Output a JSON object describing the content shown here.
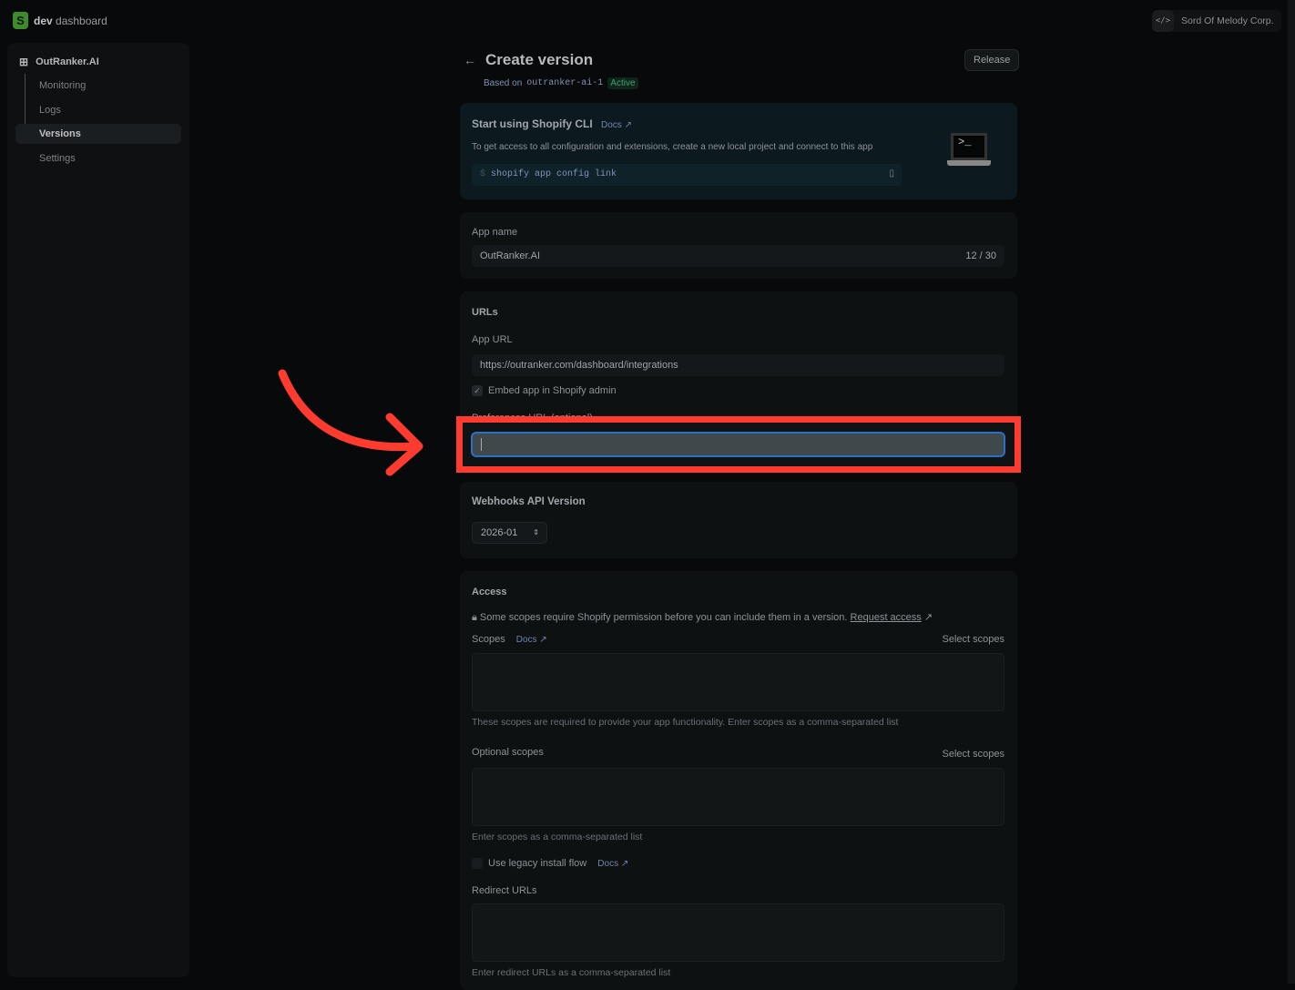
{
  "header": {
    "brand_bold": "dev",
    "brand_rest": "dashboard",
    "org_icon": "code-icon",
    "org": "Sord Of Melody Corp."
  },
  "sidebar": {
    "app": "OutRanker.AI",
    "items": [
      {
        "label": "Monitoring"
      },
      {
        "label": "Logs"
      },
      {
        "label": "Versions",
        "active": true
      },
      {
        "label": "Settings"
      }
    ]
  },
  "page": {
    "title": "Create version",
    "based_on": "Based on",
    "version": "outranker-ai-1",
    "status": "Active",
    "release": "Release"
  },
  "cli": {
    "title": "Start using Shopify CLI",
    "docs": "Docs",
    "desc": "To get access to all configuration and extensions, create a new local project and connect to this app",
    "prompt": "$",
    "command": "shopify app config link"
  },
  "app_name": {
    "label": "App name",
    "value": "OutRanker.AI",
    "count": "12 / 30"
  },
  "urls": {
    "title": "URLs",
    "app_url_label": "App URL",
    "app_url": "https://outranker.com/dashboard/integrations",
    "embed": "Embed app in Shopify admin",
    "embed_checked": true,
    "preferences_label": "Preferences URL (optional)",
    "preferences_value": ""
  },
  "webhooks": {
    "title": "Webhooks API Version",
    "value": "2026-01"
  },
  "access": {
    "title": "Access",
    "notice": "Some scopes require Shopify permission before you can include them in a version.",
    "request": "Request access",
    "scopes_label": "Scopes",
    "docs": "Docs",
    "select": "Select scopes",
    "scopes_help": "These scopes are required to provide your app functionality. Enter scopes as a comma-separated list",
    "optional_label": "Optional scopes",
    "optional_help": "Enter scopes as a comma-separated list",
    "legacy": "Use legacy install flow",
    "redirect_label": "Redirect URLs",
    "redirect_help": "Enter redirect URLs as a comma-separated list"
  },
  "annotation": {
    "color": "#ff3b30"
  }
}
